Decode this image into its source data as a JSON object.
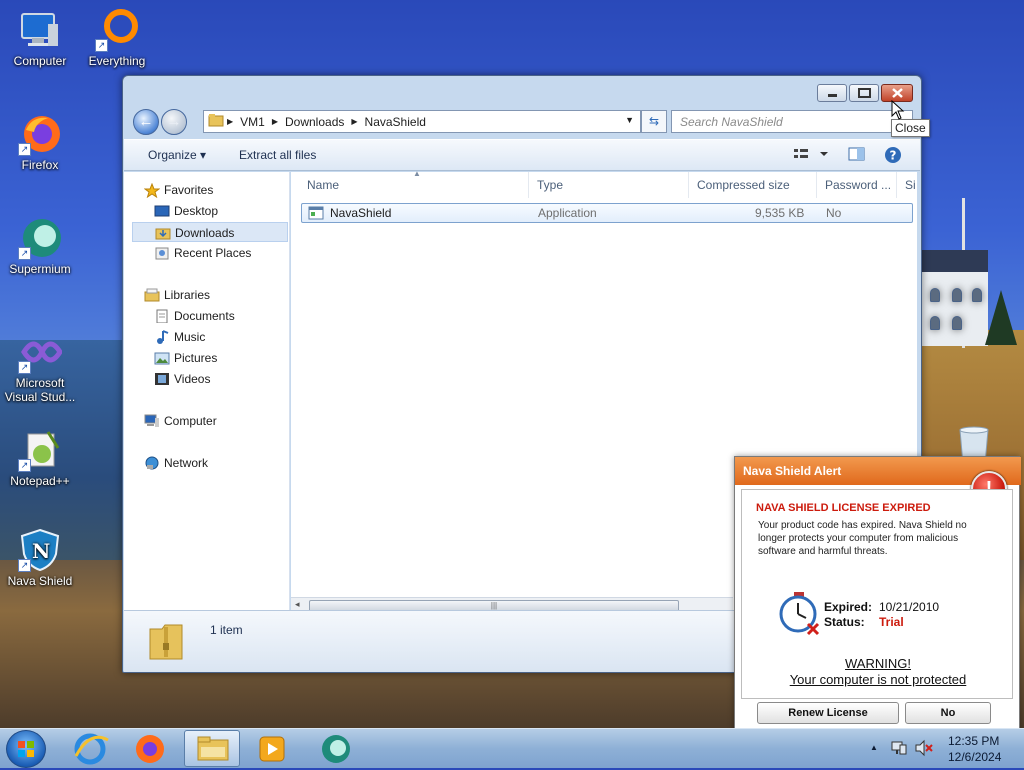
{
  "desktop": {
    "icons": [
      {
        "label": "Computer",
        "icon": "computer-icon"
      },
      {
        "label": "Everything",
        "icon": "everything-icon"
      },
      {
        "label": "Firefox",
        "icon": "firefox-icon"
      },
      {
        "label": "Supermium",
        "icon": "supermium-icon"
      },
      {
        "label": "Microsoft Visual Stud...",
        "icon": "visual-studio-icon"
      },
      {
        "label": "Notepad++",
        "icon": "notepadpp-icon"
      },
      {
        "label": "Nava Shield",
        "icon": "navashield-icon"
      }
    ]
  },
  "explorer": {
    "breadcrumb": [
      "VM1",
      "Downloads",
      "NavaShield"
    ],
    "search_placeholder": "Search NavaShield",
    "toolbar": {
      "organize": "Organize",
      "extract": "Extract all files"
    },
    "tooltip": "Close",
    "nav": {
      "favorites": "Favorites",
      "desktop": "Desktop",
      "downloads": "Downloads",
      "recent": "Recent Places",
      "libraries": "Libraries",
      "documents": "Documents",
      "music": "Music",
      "pictures": "Pictures",
      "videos": "Videos",
      "computer": "Computer",
      "network": "Network"
    },
    "columns": [
      "Name",
      "Type",
      "Compressed size",
      "Password ...",
      "Si"
    ],
    "rows": [
      {
        "name": "NavaShield",
        "type": "Application",
        "size": "9,535 KB",
        "password": "No"
      }
    ],
    "status": "1 item",
    "colors": {
      "accent": "#2f6bb8"
    }
  },
  "alert": {
    "header": "Nava Shield Alert",
    "title": "NAVA SHIELD LICENSE EXPIRED",
    "message": "Your product code has expired. Nava Shield no longer protects your computer from malicious software and harmful threats.",
    "expired_label": "Expired:",
    "expired_value": "10/21/2010",
    "status_label": "Status:",
    "status_value": "Trial",
    "warning": "WARNING!",
    "warning_sub": "Your computer is not protected",
    "renew_button": "Renew License",
    "no_button": "No",
    "colors": {
      "header": "#e67a2a",
      "danger": "#cc1b0d"
    }
  },
  "taskbar": {
    "time": "12:35 PM",
    "date": "12/6/2024"
  }
}
